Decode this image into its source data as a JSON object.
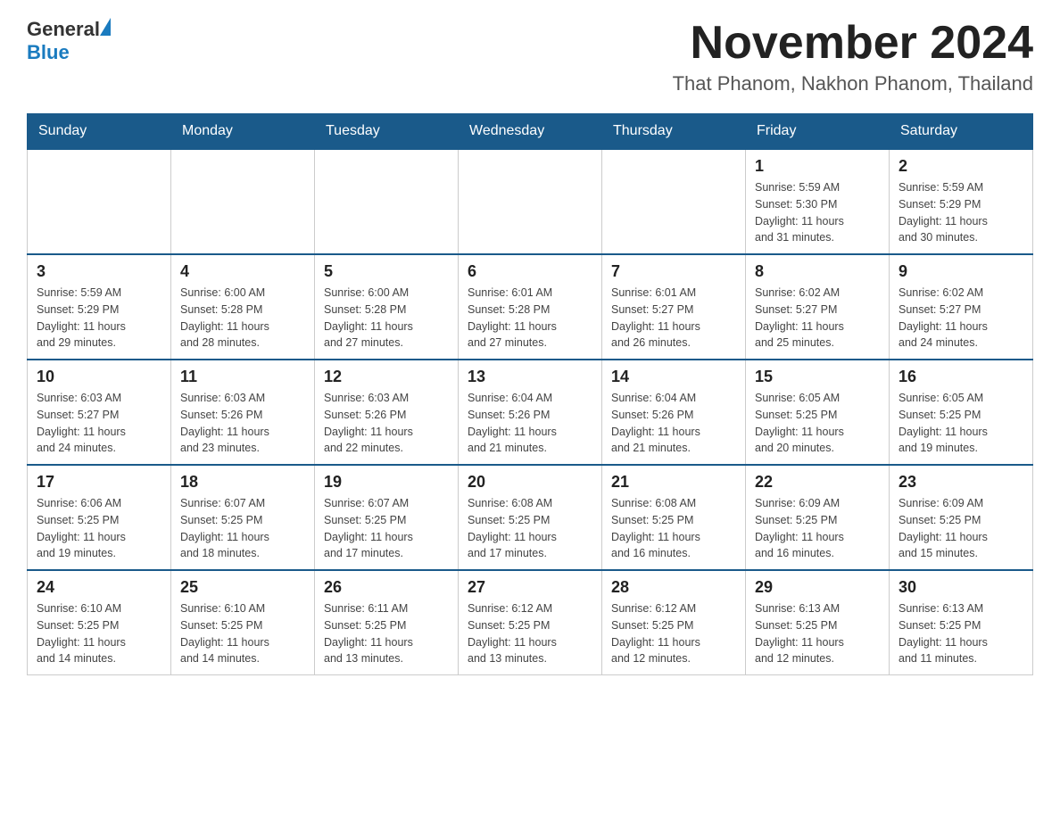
{
  "header": {
    "logo_general": "General",
    "logo_blue": "Blue",
    "month_title": "November 2024",
    "location": "That Phanom, Nakhon Phanom, Thailand"
  },
  "weekdays": [
    "Sunday",
    "Monday",
    "Tuesday",
    "Wednesday",
    "Thursday",
    "Friday",
    "Saturday"
  ],
  "weeks": [
    [
      {
        "day": "",
        "info": ""
      },
      {
        "day": "",
        "info": ""
      },
      {
        "day": "",
        "info": ""
      },
      {
        "day": "",
        "info": ""
      },
      {
        "day": "",
        "info": ""
      },
      {
        "day": "1",
        "info": "Sunrise: 5:59 AM\nSunset: 5:30 PM\nDaylight: 11 hours\nand 31 minutes."
      },
      {
        "day": "2",
        "info": "Sunrise: 5:59 AM\nSunset: 5:29 PM\nDaylight: 11 hours\nand 30 minutes."
      }
    ],
    [
      {
        "day": "3",
        "info": "Sunrise: 5:59 AM\nSunset: 5:29 PM\nDaylight: 11 hours\nand 29 minutes."
      },
      {
        "day": "4",
        "info": "Sunrise: 6:00 AM\nSunset: 5:28 PM\nDaylight: 11 hours\nand 28 minutes."
      },
      {
        "day": "5",
        "info": "Sunrise: 6:00 AM\nSunset: 5:28 PM\nDaylight: 11 hours\nand 27 minutes."
      },
      {
        "day": "6",
        "info": "Sunrise: 6:01 AM\nSunset: 5:28 PM\nDaylight: 11 hours\nand 27 minutes."
      },
      {
        "day": "7",
        "info": "Sunrise: 6:01 AM\nSunset: 5:27 PM\nDaylight: 11 hours\nand 26 minutes."
      },
      {
        "day": "8",
        "info": "Sunrise: 6:02 AM\nSunset: 5:27 PM\nDaylight: 11 hours\nand 25 minutes."
      },
      {
        "day": "9",
        "info": "Sunrise: 6:02 AM\nSunset: 5:27 PM\nDaylight: 11 hours\nand 24 minutes."
      }
    ],
    [
      {
        "day": "10",
        "info": "Sunrise: 6:03 AM\nSunset: 5:27 PM\nDaylight: 11 hours\nand 24 minutes."
      },
      {
        "day": "11",
        "info": "Sunrise: 6:03 AM\nSunset: 5:26 PM\nDaylight: 11 hours\nand 23 minutes."
      },
      {
        "day": "12",
        "info": "Sunrise: 6:03 AM\nSunset: 5:26 PM\nDaylight: 11 hours\nand 22 minutes."
      },
      {
        "day": "13",
        "info": "Sunrise: 6:04 AM\nSunset: 5:26 PM\nDaylight: 11 hours\nand 21 minutes."
      },
      {
        "day": "14",
        "info": "Sunrise: 6:04 AM\nSunset: 5:26 PM\nDaylight: 11 hours\nand 21 minutes."
      },
      {
        "day": "15",
        "info": "Sunrise: 6:05 AM\nSunset: 5:25 PM\nDaylight: 11 hours\nand 20 minutes."
      },
      {
        "day": "16",
        "info": "Sunrise: 6:05 AM\nSunset: 5:25 PM\nDaylight: 11 hours\nand 19 minutes."
      }
    ],
    [
      {
        "day": "17",
        "info": "Sunrise: 6:06 AM\nSunset: 5:25 PM\nDaylight: 11 hours\nand 19 minutes."
      },
      {
        "day": "18",
        "info": "Sunrise: 6:07 AM\nSunset: 5:25 PM\nDaylight: 11 hours\nand 18 minutes."
      },
      {
        "day": "19",
        "info": "Sunrise: 6:07 AM\nSunset: 5:25 PM\nDaylight: 11 hours\nand 17 minutes."
      },
      {
        "day": "20",
        "info": "Sunrise: 6:08 AM\nSunset: 5:25 PM\nDaylight: 11 hours\nand 17 minutes."
      },
      {
        "day": "21",
        "info": "Sunrise: 6:08 AM\nSunset: 5:25 PM\nDaylight: 11 hours\nand 16 minutes."
      },
      {
        "day": "22",
        "info": "Sunrise: 6:09 AM\nSunset: 5:25 PM\nDaylight: 11 hours\nand 16 minutes."
      },
      {
        "day": "23",
        "info": "Sunrise: 6:09 AM\nSunset: 5:25 PM\nDaylight: 11 hours\nand 15 minutes."
      }
    ],
    [
      {
        "day": "24",
        "info": "Sunrise: 6:10 AM\nSunset: 5:25 PM\nDaylight: 11 hours\nand 14 minutes."
      },
      {
        "day": "25",
        "info": "Sunrise: 6:10 AM\nSunset: 5:25 PM\nDaylight: 11 hours\nand 14 minutes."
      },
      {
        "day": "26",
        "info": "Sunrise: 6:11 AM\nSunset: 5:25 PM\nDaylight: 11 hours\nand 13 minutes."
      },
      {
        "day": "27",
        "info": "Sunrise: 6:12 AM\nSunset: 5:25 PM\nDaylight: 11 hours\nand 13 minutes."
      },
      {
        "day": "28",
        "info": "Sunrise: 6:12 AM\nSunset: 5:25 PM\nDaylight: 11 hours\nand 12 minutes."
      },
      {
        "day": "29",
        "info": "Sunrise: 6:13 AM\nSunset: 5:25 PM\nDaylight: 11 hours\nand 12 minutes."
      },
      {
        "day": "30",
        "info": "Sunrise: 6:13 AM\nSunset: 5:25 PM\nDaylight: 11 hours\nand 11 minutes."
      }
    ]
  ]
}
